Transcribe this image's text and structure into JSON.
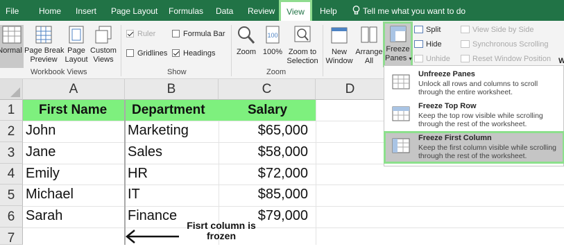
{
  "tabs": [
    "File",
    "Home",
    "Insert",
    "Page Layout",
    "Formulas",
    "Data",
    "Review",
    "View",
    "Help"
  ],
  "tell_me": "Tell me what you want to do",
  "workbook_views": {
    "normal": "Normal",
    "page_break_1": "Page Break",
    "page_break_2": "Preview",
    "page_layout_1": "Page",
    "page_layout_2": "Layout",
    "custom_1": "Custom",
    "custom_2": "Views",
    "group": "Workbook Views"
  },
  "show": {
    "ruler": "Ruler",
    "formula_bar": "Formula Bar",
    "gridlines": "Gridlines",
    "headings": "Headings",
    "group": "Show"
  },
  "zoom": {
    "zoom": "Zoom",
    "hundred": "100%",
    "zoom_sel_1": "Zoom to",
    "zoom_sel_2": "Selection",
    "group": "Zoom"
  },
  "window": {
    "new_1": "New",
    "new_2": "Window",
    "arrange_1": "Arrange",
    "arrange_2": "All",
    "freeze_1": "Freeze",
    "freeze_2": "Panes",
    "split": "Split",
    "hide": "Hide",
    "unhide": "Unhide",
    "side_by_side": "View Side by Side",
    "sync_scroll": "Synchronous Scrolling",
    "reset_pos": "Reset Window Position",
    "edge_label": "W"
  },
  "columns": [
    "A",
    "B",
    "C",
    "D"
  ],
  "rows": [
    "1",
    "2",
    "3",
    "4",
    "5",
    "6",
    "7"
  ],
  "table": {
    "headers": [
      "First Name",
      "Department",
      "Salary"
    ],
    "data": [
      [
        "John",
        "Marketing",
        "$65,000"
      ],
      [
        "Jane",
        "Sales",
        "$58,000"
      ],
      [
        "Emily",
        "HR",
        "$72,000"
      ],
      [
        "Michael",
        "IT",
        "$85,000"
      ],
      [
        "Sarah",
        "Finance",
        "$79,000"
      ]
    ]
  },
  "menu": [
    {
      "title": "Unfreeze Panes",
      "desc": "Unlock all rows and columns to scroll through the entire worksheet."
    },
    {
      "title": "Freeze Top Row",
      "desc": "Keep the top row visible while scrolling through the rest of the worksheet."
    },
    {
      "title": "Freeze First Column",
      "desc": "Keep the first column visible while scrolling through the rest of the worksheet."
    }
  ],
  "annotation": "Fisrt column is frozen",
  "colors": {
    "ribbon_green": "#217346",
    "header_fill": "#7ef07e",
    "highlight_border": "#8fdc8f"
  }
}
